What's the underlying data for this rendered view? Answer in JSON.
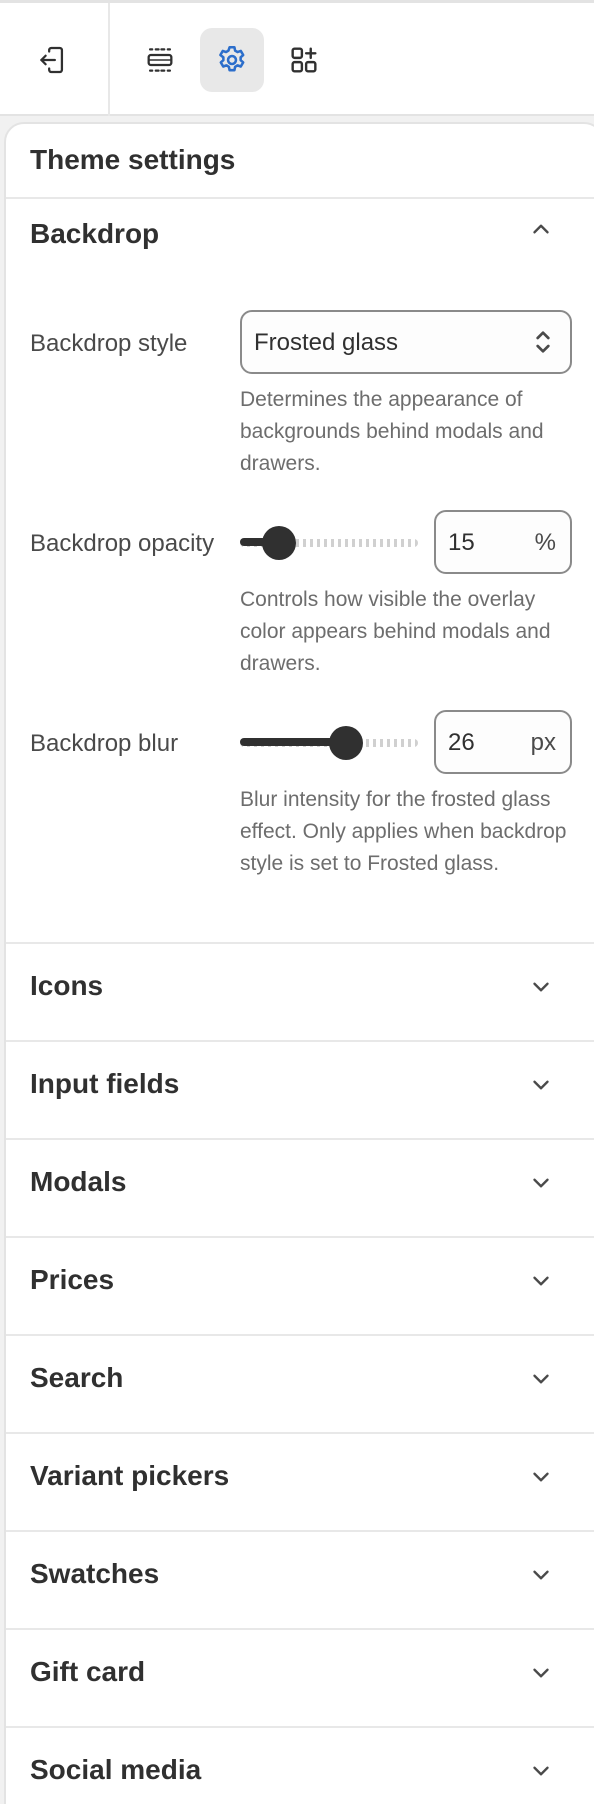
{
  "panel": {
    "title": "Theme settings"
  },
  "backdrop": {
    "title": "Backdrop",
    "style": {
      "label": "Backdrop style",
      "value": "Frosted glass",
      "help": "Determines the appearance of backgrounds behind modals and drawers."
    },
    "opacity": {
      "label": "Backdrop opacity",
      "value": "15",
      "unit": "%",
      "fraction": 0.15,
      "help": "Controls how visible the overlay color appears behind modals and drawers."
    },
    "blur": {
      "label": "Backdrop blur",
      "value": "26",
      "unit": "px",
      "fraction": 0.62,
      "help": "Blur intensity for the frosted glass effect. Only applies when backdrop style is set to Frosted glass."
    }
  },
  "sections": [
    {
      "label": "Icons"
    },
    {
      "label": "Input fields"
    },
    {
      "label": "Modals"
    },
    {
      "label": "Prices"
    },
    {
      "label": "Search"
    },
    {
      "label": "Variant pickers"
    },
    {
      "label": "Swatches"
    },
    {
      "label": "Gift card"
    },
    {
      "label": "Social media"
    }
  ],
  "colors": {
    "accent": "#2c6ecb",
    "active_bg": "#e8e8e8",
    "text": "#303030"
  }
}
